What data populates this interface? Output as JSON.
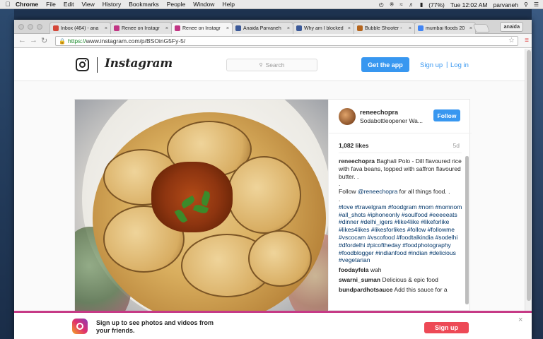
{
  "menubar": {
    "apple": "",
    "items": [
      "Chrome",
      "File",
      "Edit",
      "View",
      "History",
      "Bookmarks",
      "People",
      "Window",
      "Help"
    ],
    "battery": "(77%)",
    "clock": "Tue 12:02 AM",
    "user": "parvaneh"
  },
  "browser": {
    "profile": "anaida",
    "tabs": [
      {
        "title": "Inbox (464) - ana",
        "color": "#d44638"
      },
      {
        "title": "Renee on Instagr",
        "color": "#c13584"
      },
      {
        "title": "Renee on Instagr",
        "color": "#c13584"
      },
      {
        "title": "Anaida Parvaneh",
        "color": "#3b5998"
      },
      {
        "title": "Why am I blocked",
        "color": "#3b5998"
      },
      {
        "title": "Bubble Shooter -",
        "color": "#b5651d"
      },
      {
        "title": "mumbai floods 20",
        "color": "#4285f4"
      }
    ],
    "url_scheme": "https://",
    "url_rest": "www.instagram.com/p/BSOinG5Fy-5/"
  },
  "instagram": {
    "wordmark": "Instagram",
    "search_placeholder": "Search",
    "get_app": "Get the app",
    "sign_up": "Sign up",
    "separator": "|",
    "log_in": "Log in"
  },
  "post": {
    "username": "reneechopra",
    "location": "Sodabottleopener Wa...",
    "follow": "Follow",
    "likes": "1,082 likes",
    "ago": "5d",
    "caption_user": "reneechopra",
    "caption_text": "Baghali Polo - Dill flavoured rice with fava beans, topped with saffron flavoured butter. .",
    "caption_dot1": ".",
    "caption_follow_pre": "Follow ",
    "caption_follow_tag": "@reneechopra",
    "caption_follow_post": " for all things food. .",
    "caption_dot2": ".",
    "hashtags": "#love #travelgram #foodgram #nom #nomnom #all_shots #iphoneonly #soulfood #eeeeeats #dinner #delhi_igers #like4like #likeforlike #likes4likes #likesforlikes #follow #followme #vscocam #vscofood #foodtalkindia #sodelhi #dfordelhi #picoftheday #foodphotography #foodblogger #indianfood #indian #delicious #vegetarian",
    "comments": [
      {
        "user": "foodayfela",
        "text": "wah"
      },
      {
        "user": "swarni_suman",
        "text": "Delicious & epic food"
      },
      {
        "user": "bundpardhotsauce",
        "text": "Add this sauce for a"
      }
    ]
  },
  "banner": {
    "text": "Sign up to see photos and videos from your friends.",
    "button": "Sign up",
    "close": "×"
  }
}
